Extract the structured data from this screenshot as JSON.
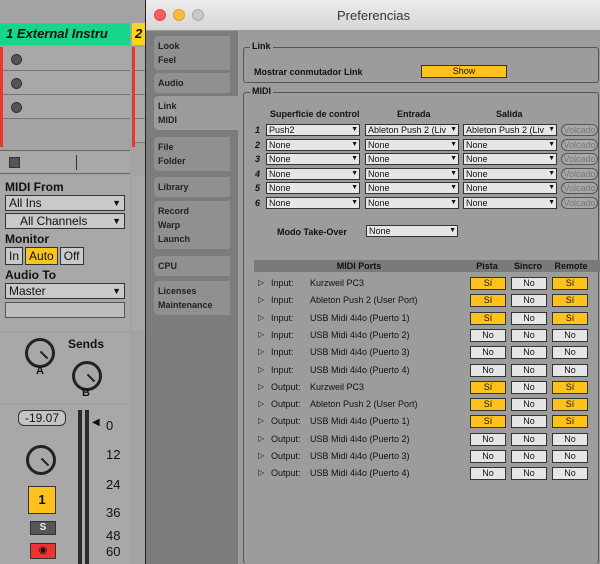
{
  "mixer": {
    "track_name": "1 External Instru",
    "track2_name": "2",
    "midi_from_label": "MIDI From",
    "midi_from_value": "All Ins",
    "channel_value": "All Channels",
    "monitor_label": "Monitor",
    "monitor_in": "In",
    "monitor_auto": "Auto",
    "monitor_off": "Off",
    "audio_to_label": "Audio To",
    "audio_to_value": "Master",
    "sends_label": "Sends",
    "send_a": "A",
    "send_b": "B",
    "volume": "-19.07",
    "scale": [
      "0",
      "12",
      "24",
      "36",
      "48",
      "60"
    ],
    "track_number": "1",
    "solo": "S"
  },
  "prefs": {
    "title": "Preferencias",
    "tabs": [
      {
        "lines": [
          "Look",
          "Feel"
        ]
      },
      {
        "lines": [
          "Audio"
        ]
      },
      {
        "lines": [
          "Link",
          "MIDI"
        ]
      },
      {
        "lines": [
          "File",
          "Folder"
        ]
      },
      {
        "lines": [
          "Library"
        ]
      },
      {
        "lines": [
          "Record",
          "Warp",
          "Launch"
        ]
      },
      {
        "lines": [
          "CPU"
        ]
      },
      {
        "lines": [
          "Licenses",
          "Maintenance"
        ]
      }
    ],
    "link_section": "Link",
    "link_label": "Mostrar conmutador Link",
    "show_button": "Show",
    "midi_section": "MIDI",
    "col_surface": "Superficie de control",
    "col_input": "Entrada",
    "col_output": "Salida",
    "surfaces": [
      {
        "n": "1",
        "surface": "Push2",
        "input": "Ableton Push 2 (Liv",
        "output": "Ableton Push 2 (Liv",
        "dump": "Volcado"
      },
      {
        "n": "2",
        "surface": "None",
        "input": "None",
        "output": "None",
        "dump": "Volcado"
      },
      {
        "n": "3",
        "surface": "None",
        "input": "None",
        "output": "None",
        "dump": "Volcado"
      },
      {
        "n": "4",
        "surface": "None",
        "input": "None",
        "output": "None",
        "dump": "Volcado"
      },
      {
        "n": "5",
        "surface": "None",
        "input": "None",
        "output": "None",
        "dump": "Volcado"
      },
      {
        "n": "6",
        "surface": "None",
        "input": "None",
        "output": "None",
        "dump": "Volcado"
      }
    ],
    "takeover_label": "Modo Take-Over",
    "takeover_value": "None",
    "ports_header": "MIDI Ports",
    "col_track": "Pista",
    "col_sync": "Sincro",
    "col_remote": "Remote",
    "ports": [
      {
        "type": "Input:",
        "name": "Kurzweil PC3",
        "track": "Sí",
        "sync": "No",
        "remote": "Sí"
      },
      {
        "type": "Input:",
        "name": "Ableton Push 2 (User Port)",
        "track": "Sí",
        "sync": "No",
        "remote": "Sí"
      },
      {
        "type": "Input:",
        "name": "USB Midi 4i4o (Puerto 1)",
        "track": "Sí",
        "sync": "No",
        "remote": "Sí"
      },
      {
        "type": "Input:",
        "name": "USB Midi 4i4o (Puerto 2)",
        "track": "No",
        "sync": "No",
        "remote": "No"
      },
      {
        "type": "Input:",
        "name": "USB Midi 4i4o (Puerto 3)",
        "track": "No",
        "sync": "No",
        "remote": "No"
      },
      {
        "type": "Input:",
        "name": "USB Midi 4i4o (Puerto 4)",
        "track": "No",
        "sync": "No",
        "remote": "No"
      },
      {
        "type": "Output:",
        "name": "Kurzweil PC3",
        "track": "Sí",
        "sync": "No",
        "remote": "Sí"
      },
      {
        "type": "Output:",
        "name": "Ableton Push 2 (User Port)",
        "track": "Sí",
        "sync": "No",
        "remote": "Sí"
      },
      {
        "type": "Output:",
        "name": "USB Midi 4i4o (Puerto 1)",
        "track": "Sí",
        "sync": "No",
        "remote": "Sí"
      },
      {
        "type": "Output:",
        "name": "USB Midi 4i4o (Puerto 2)",
        "track": "No",
        "sync": "No",
        "remote": "No"
      },
      {
        "type": "Output:",
        "name": "USB Midi 4i4o (Puerto 3)",
        "track": "No",
        "sync": "No",
        "remote": "No"
      },
      {
        "type": "Output:",
        "name": "USB Midi 4i4o (Puerto 4)",
        "track": "No",
        "sync": "No",
        "remote": "No"
      }
    ]
  },
  "colors": {
    "accent": "#ffc21c",
    "track": "#16d68a",
    "record": "#e33333"
  }
}
